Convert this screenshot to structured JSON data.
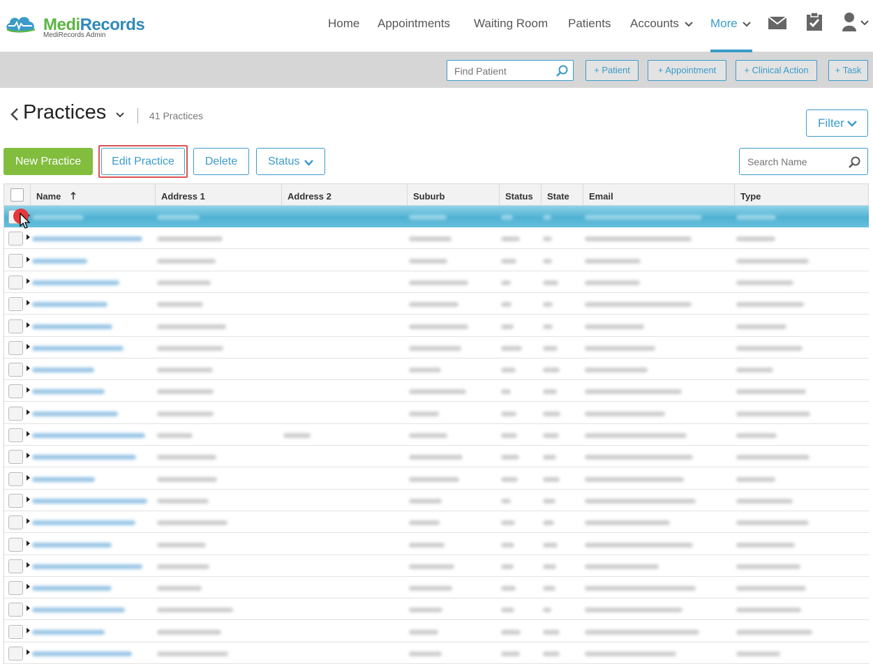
{
  "brand": {
    "name_part1": "Medi",
    "name_part2": "Records",
    "subtitle": "MediRecords Admin"
  },
  "nav": {
    "home": "Home",
    "appointments": "Appointments",
    "waiting_room": "Waiting Room",
    "patients": "Patients",
    "accounts": "Accounts",
    "more": "More",
    "active_item": "More"
  },
  "icons": [
    "mail-icon",
    "clipboard-check-icon",
    "user-icon",
    "chevron-down-icon",
    "search-icon",
    "chevron-left-icon",
    "mouse-cursor-icon"
  ],
  "toolbar": {
    "find_patient_placeholder": "Find Patient",
    "add_patient": "+ Patient",
    "add_appointment": "+ Appointment",
    "add_clinical_action": "+ Clinical Action",
    "add_task": "+ Task"
  },
  "page": {
    "title": "Practices",
    "count_label": "41 Practices",
    "filter_label": "Filter"
  },
  "actions": {
    "new_practice": "New Practice",
    "edit_practice": "Edit Practice",
    "delete": "Delete",
    "status": "Status",
    "search_placeholder": "Search Name"
  },
  "table": {
    "columns": [
      "Name",
      "Address 1",
      "Address 2",
      "Suburb",
      "Status",
      "State",
      "Email",
      "Type"
    ],
    "sorted_column": "Name",
    "sort_direction": "ascending",
    "visible_row_count": 21,
    "selected_row_index": 0,
    "rows_note_hidden": "row contents are blurred in the screenshot"
  },
  "colors": {
    "accent": "#3a9bc9",
    "primary_button": "#82bd3e",
    "selected_row": "#5dbbd8",
    "toolbar_bg": "#d6d6d6",
    "highlight_box": "#e05050"
  }
}
